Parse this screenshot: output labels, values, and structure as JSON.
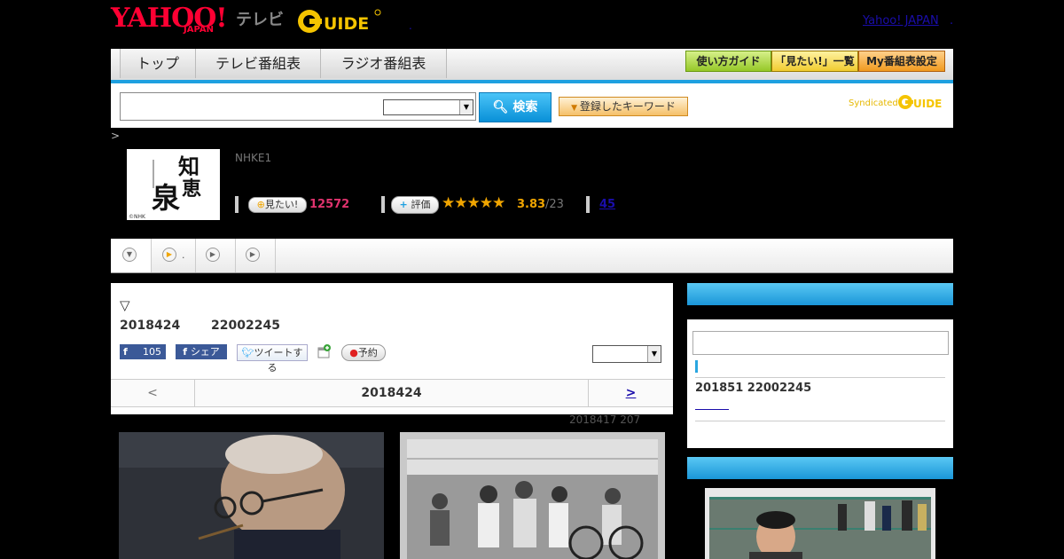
{
  "header": {
    "logo_yahoo": "YAHOO!",
    "logo_japan": "JAPAN",
    "logo_tv": "テレビ",
    "logo_gguide_alt": "G-GUIDE",
    "yahoo_link": "Yahoo! JAPAN",
    "link_dot": ".",
    "mid_dot": "."
  },
  "nav": {
    "tabs": [
      "トップ",
      "テレビ番組表",
      "ラジオ番組表"
    ],
    "buttons": [
      "使い方ガイド",
      "「見たい!」一覧",
      "My番組表設定"
    ]
  },
  "search": {
    "button_label": "検索",
    "keyword_button": "登録したキーワード",
    "syndicated": "Syndicated"
  },
  "program": {
    "breadcrumb": ">",
    "channel": "NHKE1",
    "mitai_label": "見たい!",
    "mitai_count": "12572",
    "hyoka_label": "評価",
    "stars": "★★★★★",
    "rating": "3.83",
    "rating_count": "/23",
    "review_count": "45"
  },
  "subtabs": {
    "tab2_suffix": "."
  },
  "main": {
    "marker": "▽",
    "date": "2018424",
    "time": "22002245",
    "fb_like_count": "105",
    "fb_share": "シェア",
    "tweet": "ツイートする",
    "reserve": "予約",
    "pager_prev": "<",
    "pager_date": "2018424",
    "pager_next": ">",
    "prev_note": "2018417  207"
  },
  "sidebar": {
    "date": "201851  22002245"
  },
  "colors": {
    "accent_blue": "#1ea0e0",
    "mitai_pink": "#e0336e",
    "star_orange": "#f0a500",
    "link_blue": "#1a0dab"
  }
}
